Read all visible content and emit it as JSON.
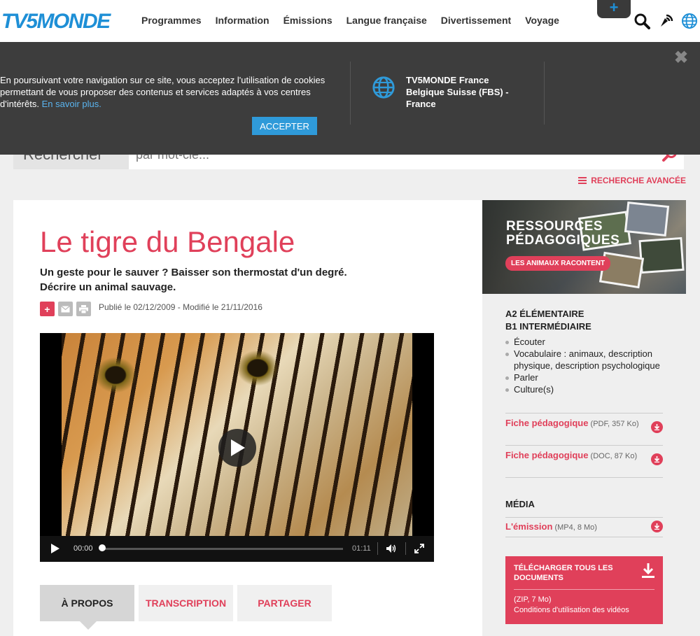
{
  "header": {
    "logo": "TV5MONDE",
    "nav": [
      "Programmes",
      "Information",
      "Émissions",
      "Langue française",
      "Divertissement",
      "Voyage"
    ],
    "plus": "+"
  },
  "cookie": {
    "text": "En poursuivant votre navigation sur ce site, vous acceptez l'utilisation de cookies permettant de vous proposer des contenus et services adaptés à vos centres d'intérêts.",
    "link": "En savoir plus.",
    "accept": "ACCEPTER",
    "region": "TV5MONDE France Belgique Suisse (FBS) - France",
    "close": "✖"
  },
  "search": {
    "label": "Rechercher",
    "placeholder": "par mot-clé...",
    "advanced": "RECHERCHE AVANCÉE"
  },
  "article": {
    "title": "Le tigre du Bengale",
    "subtitle_1": "Un geste pour le sauver ? Baisser son thermostat d'un degré.",
    "subtitle_2": "Décrire un animal sauvage.",
    "meta": "Publié le 02/12/2009 - Modifié le 21/11/2016",
    "share_plus": "+"
  },
  "player": {
    "current_time": "00:00",
    "duration": "01:11",
    "progress": 0
  },
  "tabs": [
    "À PROPOS",
    "TRANSCRIPTION",
    "PARTAGER"
  ],
  "sidebar": {
    "promo_title_1": "RESSOURCES",
    "promo_title_2": "PÉDAGOGIQUES",
    "promo_badge": "LES ANIMAUX RACONTENT",
    "level_1": "A2 ÉLÉMENTAIRE",
    "level_2": "B1 INTERMÉDIAIRE",
    "skills": [
      "Écouter",
      "Vocabulaire : animaux, description physique, description psychologique",
      "Parler",
      "Culture(s)"
    ],
    "downloads": [
      {
        "label": "Fiche pédagogique",
        "info": "(PDF, 357 Ko)"
      },
      {
        "label": "Fiche pédagogique",
        "info": "(DOC, 87 Ko)"
      }
    ],
    "media_title": "MÉDIA",
    "media": {
      "label": "L'émission",
      "info": "(MP4, 8 Mo)"
    },
    "download_all": {
      "title": "TÉLÉCHARGER TOUS LES DOCUMENTS",
      "size": "(ZIP, 7 Mo)",
      "conditions": "Conditions d'utilisation des vidéos"
    }
  },
  "colors": {
    "accent": "#e0405a",
    "brand": "#1e8fd6",
    "banner": "#3d3d3d"
  }
}
